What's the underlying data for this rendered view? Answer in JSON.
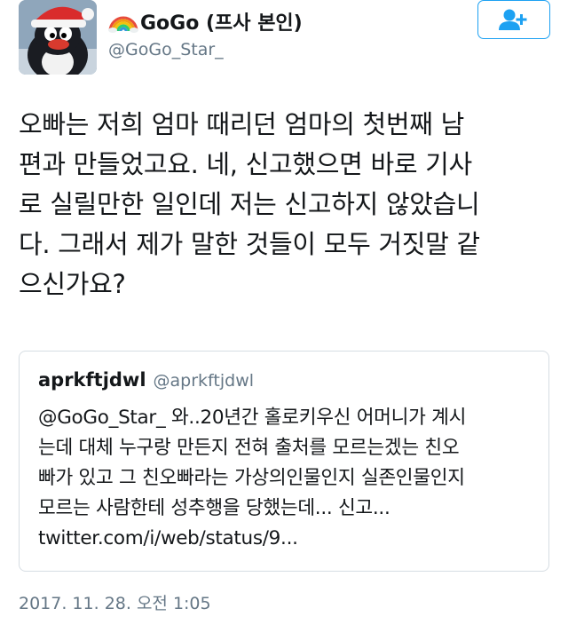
{
  "user": {
    "display_name": "GoGo (프사 본인)",
    "handle": "@GoGo_Star_",
    "name_emoji": "rainbow-icon"
  },
  "follow_button": {
    "icon": "add-user-icon"
  },
  "tweet": {
    "text": "오빠는 저희 엄마 때리던 엄마의 첫번째 남\n편과 만들었고요. 네, 신고했으면 바로 기사\n로 실릴만한 일인데 저는 신고하지 않았습니\n다. 그래서 제가 말한 것들이 모두 거짓말 같\n으신가요?",
    "timestamp": "2017. 11. 28. 오전 1:05"
  },
  "quoted_tweet": {
    "name": "aprkftjdwl",
    "handle": "@aprkftjdwl",
    "text": "@GoGo_Star_ 와..20년간 홀로키우신 어머니가 계시\n는데 대체 누구랑 만든지 전혀 출처를 모르는겠는 친오\n빠가 있고 그 친오빠라는 가상의인물인지 실존인물인지\n모르는 사람한테 성추행을 당했는데... 신고...\ntwitter.com/i/web/status/9..."
  },
  "colors": {
    "accent": "#1da1f2",
    "secondary_text": "#657786",
    "border": "#d6dde3"
  }
}
